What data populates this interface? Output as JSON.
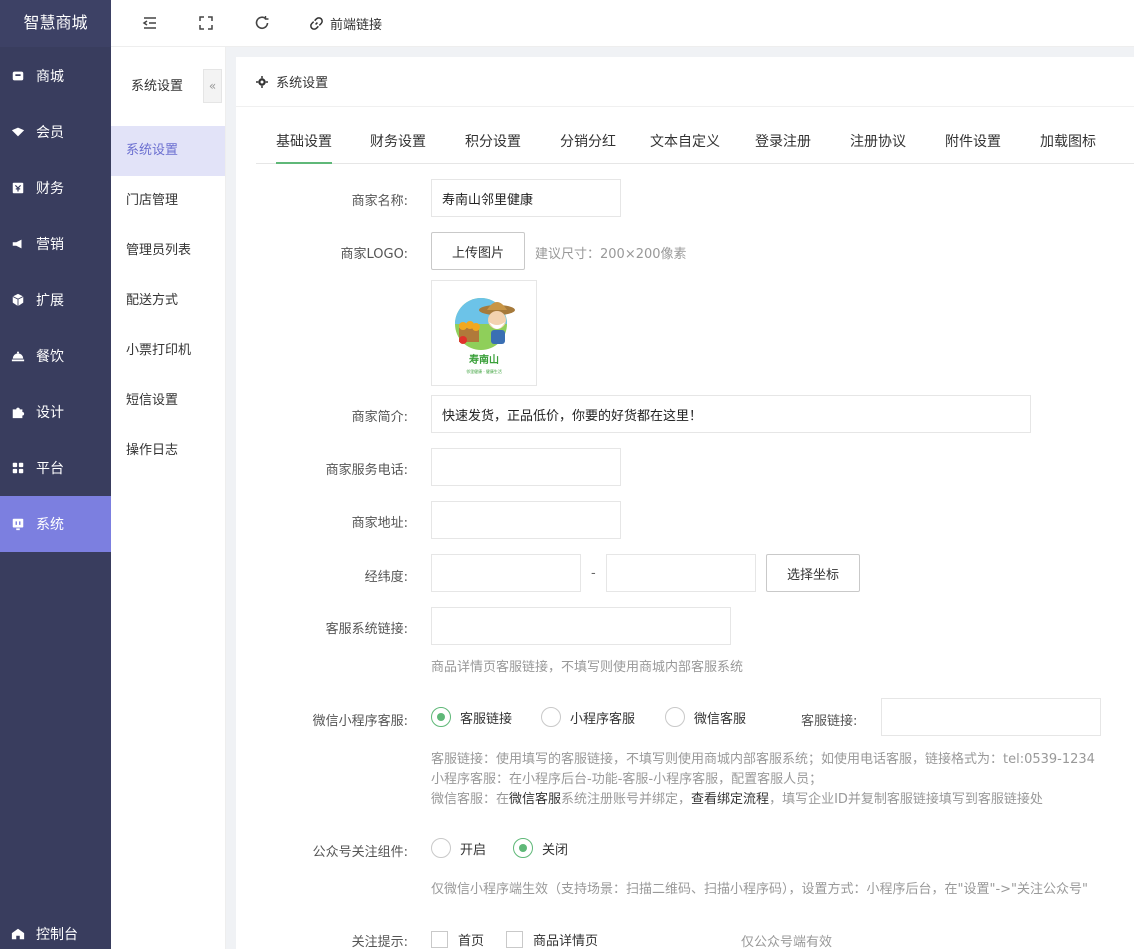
{
  "app": {
    "brand": "智慧商城"
  },
  "sidebar": {
    "items": [
      {
        "label": "商城",
        "icon": "store-icon"
      },
      {
        "label": "会员",
        "icon": "member-icon"
      },
      {
        "label": "财务",
        "icon": "finance-icon"
      },
      {
        "label": "营销",
        "icon": "megaphone-icon"
      },
      {
        "label": "扩展",
        "icon": "cube-icon"
      },
      {
        "label": "餐饮",
        "icon": "dining-icon"
      },
      {
        "label": "设计",
        "icon": "puzzle-icon"
      },
      {
        "label": "平台",
        "icon": "grid-icon"
      },
      {
        "label": "系统",
        "icon": "system-icon"
      }
    ],
    "active": "系统",
    "console_label": "控制台"
  },
  "topbar": {
    "frontend_link_label": "前端链接"
  },
  "submenu": {
    "title": "系统设置",
    "collapse": "«",
    "items": [
      "系统设置",
      "门店管理",
      "管理员列表",
      "配送方式",
      "小票打印机",
      "短信设置",
      "操作日志"
    ],
    "active": "系统设置"
  },
  "panel": {
    "title": "系统设置",
    "tabs": [
      "基础设置",
      "财务设置",
      "积分设置",
      "分销分红",
      "文本自定义",
      "登录注册",
      "注册协议",
      "附件设置",
      "加载图标"
    ],
    "active_tab": "基础设置"
  },
  "form": {
    "merchant_name": {
      "label": "商家名称:",
      "value": "寿南山邻里健康"
    },
    "logo": {
      "label": "商家LOGO:",
      "upload_button": "上传图片",
      "size_hint": "建议尺寸：200×200像素",
      "logo_text": "寿南山",
      "logo_subtext": "邻里健康 · 健康生活"
    },
    "intro": {
      "label": "商家简介:",
      "value": "快速发货，正品低价，你要的好货都在这里！"
    },
    "phone": {
      "label": "商家服务电话:",
      "value": ""
    },
    "address": {
      "label": "商家地址:",
      "value": ""
    },
    "coords": {
      "label": "经纬度:",
      "lng": "",
      "lat": "",
      "separator": "-",
      "pick_button": "选择坐标"
    },
    "cs_link": {
      "label": "客服系统链接:",
      "value": "",
      "hint": "商品详情页客服链接，不填写则使用商城内部客服系统"
    },
    "wx_cs": {
      "label": "微信小程序客服:",
      "options": [
        "客服链接",
        "小程序客服",
        "微信客服"
      ],
      "selected": "客服链接",
      "link_label": "客服链接:",
      "link_value": "",
      "hint1": "客服链接：使用填写的客服链接，不填写则使用商城内部客服系统；如使用电话客服，链接格式为：tel:0539-1234",
      "hint2": "小程序客服：在小程序后台-功能-客服-小程序客服，配置客服人员；",
      "hint3_a": "微信客服：在",
      "hint3_b": "微信客服",
      "hint3_c": "系统注册账号并绑定，",
      "hint3_d": "查看绑定流程",
      "hint3_e": "，填写企业ID并复制客服链接填写到客服链接处"
    },
    "mp_follow": {
      "label": "公众号关注组件:",
      "options": [
        "开启",
        "关闭"
      ],
      "selected": "关闭",
      "hint": "仅微信小程序端生效（支持场景：扫描二维码、扫描小程序码），设置方式：小程序后台，在\"设置\"->\"关注公众号\""
    },
    "follow_tip": {
      "label": "关注提示:",
      "options": [
        "首页",
        "商品详情页"
      ],
      "hint": "仅公众号端有效"
    }
  }
}
